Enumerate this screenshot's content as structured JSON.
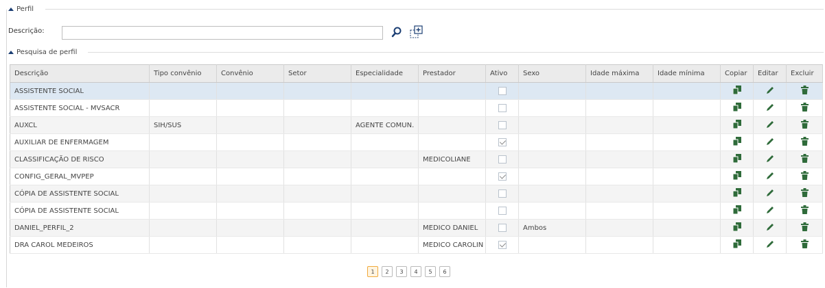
{
  "perfil": {
    "section_title": "Perfil",
    "description_label": "Descrição:",
    "description_value": "",
    "description_placeholder": ""
  },
  "pesquisa": {
    "section_title": "Pesquisa de perfil"
  },
  "table": {
    "columns": [
      "Descrição",
      "Tipo convênio",
      "Convênio",
      "Setor",
      "Especialidade",
      "Prestador",
      "Ativo",
      "Sexo",
      "Idade máxima",
      "Idade mínima",
      "Copiar",
      "Editar",
      "Excluir"
    ],
    "rows": [
      {
        "descricao": "ASSISTENTE SOCIAL",
        "tipo_convenio": "",
        "convenio": "",
        "setor": "",
        "especialidade": "",
        "prestador": "",
        "ativo": false,
        "sexo": "",
        "idade_max": "",
        "idade_min": ""
      },
      {
        "descricao": "ASSISTENTE SOCIAL - MVSACR",
        "tipo_convenio": "",
        "convenio": "",
        "setor": "",
        "especialidade": "",
        "prestador": "",
        "ativo": false,
        "sexo": "",
        "idade_max": "",
        "idade_min": ""
      },
      {
        "descricao": "AUXCL",
        "tipo_convenio": "SIH/SUS",
        "convenio": "",
        "setor": "",
        "especialidade": "AGENTE COMUN.",
        "prestador": "",
        "ativo": false,
        "sexo": "",
        "idade_max": "",
        "idade_min": ""
      },
      {
        "descricao": "AUXILIAR DE ENFERMAGEM",
        "tipo_convenio": "",
        "convenio": "",
        "setor": "",
        "especialidade": "",
        "prestador": "",
        "ativo": true,
        "sexo": "",
        "idade_max": "",
        "idade_min": ""
      },
      {
        "descricao": "CLASSIFICAÇÃO DE RISCO",
        "tipo_convenio": "",
        "convenio": "",
        "setor": "",
        "especialidade": "",
        "prestador": "MEDICOLIANE",
        "ativo": false,
        "sexo": "",
        "idade_max": "",
        "idade_min": ""
      },
      {
        "descricao": "CONFIG_GERAL_MVPEP",
        "tipo_convenio": "",
        "convenio": "",
        "setor": "",
        "especialidade": "",
        "prestador": "",
        "ativo": true,
        "sexo": "",
        "idade_max": "",
        "idade_min": ""
      },
      {
        "descricao": "CÓPIA DE ASSISTENTE SOCIAL",
        "tipo_convenio": "",
        "convenio": "",
        "setor": "",
        "especialidade": "",
        "prestador": "",
        "ativo": false,
        "sexo": "",
        "idade_max": "",
        "idade_min": ""
      },
      {
        "descricao": "CÓPIA DE ASSISTENTE SOCIAL",
        "tipo_convenio": "",
        "convenio": "",
        "setor": "",
        "especialidade": "",
        "prestador": "",
        "ativo": false,
        "sexo": "",
        "idade_max": "",
        "idade_min": ""
      },
      {
        "descricao": "DANIEL_PERFIL_2",
        "tipo_convenio": "",
        "convenio": "",
        "setor": "",
        "especialidade": "",
        "prestador": "MEDICO DANIEL",
        "ativo": false,
        "sexo": "Ambos",
        "idade_max": "",
        "idade_min": ""
      },
      {
        "descricao": "DRA CAROL MEDEIROS",
        "tipo_convenio": "",
        "convenio": "",
        "setor": "",
        "especialidade": "",
        "prestador": "MEDICO CAROLIN",
        "ativo": true,
        "sexo": "",
        "idade_max": "",
        "idade_min": ""
      }
    ],
    "selected_row": 0
  },
  "pagination": {
    "pages": [
      "1",
      "2",
      "3",
      "4",
      "5",
      "6"
    ],
    "current": "1"
  },
  "icons": {
    "search": "search-icon",
    "add": "add-icon",
    "copy": "copy-icon",
    "edit": "edit-icon",
    "delete": "trash-icon"
  },
  "colors": {
    "accent": "#1b3e73",
    "icon_green": "#2f6b3a",
    "selected_row": "#dde8f3",
    "header_bg": "#ebebeb",
    "active_page": "#f0a93b"
  }
}
